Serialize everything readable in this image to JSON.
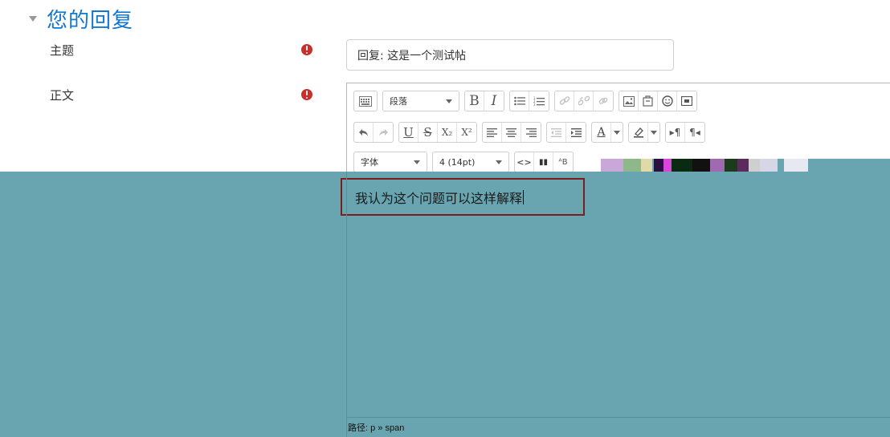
{
  "section": {
    "title": "您的回复"
  },
  "form": {
    "subject": {
      "label": "主题",
      "value": "回复: 这是一个测试帖"
    },
    "body": {
      "label": "正文"
    }
  },
  "toolbar": {
    "row1": {
      "toggle_icon": "toolbar-toggle-icon",
      "format_dropdown": "段落",
      "bold": "B",
      "italic": "I",
      "icons": [
        "unordered-list-icon",
        "ordered-list-icon",
        "link-icon",
        "unlink-icon",
        "anchor-icon",
        "image-icon",
        "media-icon",
        "emoticon-icon",
        "video-icon"
      ]
    },
    "row2": {
      "underline": "U",
      "strike": "S",
      "subscript": "X₂",
      "superscript": "X²",
      "icons": [
        "undo-icon",
        "redo-icon",
        "align-left-icon",
        "align-center-icon",
        "align-right-icon",
        "outdent-icon",
        "indent-icon",
        "text-color-icon",
        "background-color-icon",
        "ltr-icon",
        "rtl-icon"
      ],
      "text_color_glyph": "A",
      "ltr_glyph": "▸¶",
      "rtl_glyph": "¶◂"
    },
    "row3": {
      "font_family": "字体",
      "font_size": "4 (14pt)",
      "code_glyph": "<>",
      "search_glyph": "▮▮",
      "case_glyph": "ᴬB",
      "fullscreen_glyph": "⛶"
    }
  },
  "editor": {
    "content": "我认为这个问题可以这样解释",
    "path": "路径: p » span"
  },
  "colors": {
    "accent_blue": "#1177d1",
    "required_red": "#c9302c",
    "overlay_teal": "#68a5b1",
    "highlight_border": "#7a1f1f"
  }
}
